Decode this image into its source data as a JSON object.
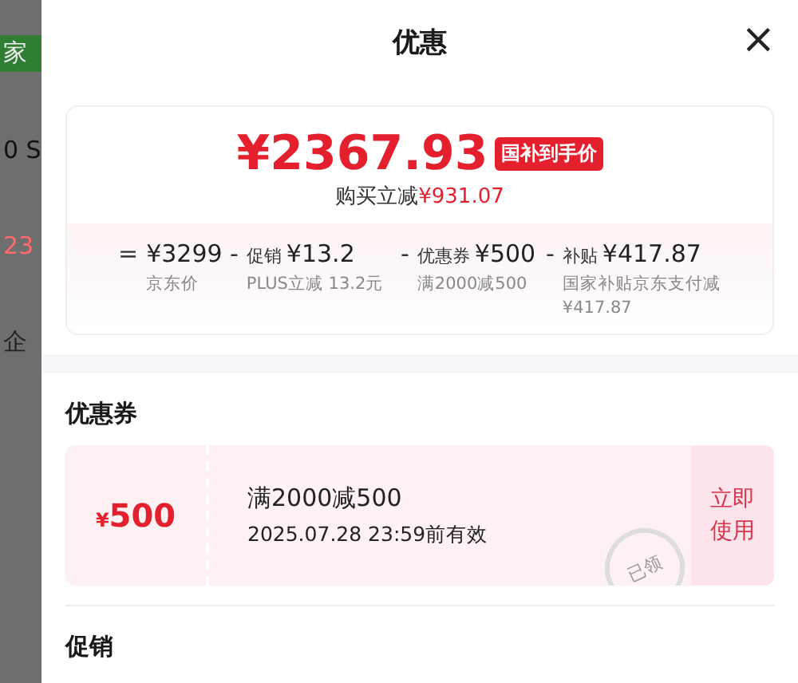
{
  "backdrop": {
    "texts": [
      "家",
      "0 S",
      "23",
      "企"
    ]
  },
  "dialog": {
    "title": "优惠",
    "close": "×"
  },
  "price_card": {
    "price": "¥2367.93",
    "badge": "国补到手价",
    "saving_label": "购买立减",
    "saving_value": "¥931.07",
    "breakdown": [
      {
        "op": "=",
        "value": "¥3299",
        "note": "京东价"
      },
      {
        "op": "-",
        "label": "促销",
        "value": "¥13.2",
        "note": "PLUS立减 13.2元"
      },
      {
        "op": "-",
        "label": "优惠券",
        "value": "¥500",
        "note": "满2000减500"
      },
      {
        "op": "-",
        "label": "补贴",
        "value": "¥417.87",
        "note": "国家补贴京东支付减¥417.87"
      }
    ]
  },
  "coupons": {
    "heading": "优惠券",
    "items": [
      {
        "currency": "¥",
        "amount": "500",
        "condition": "满2000减500",
        "validity": "2025.07.28 23:59前有效",
        "stamp": "已领",
        "claimed": true,
        "action": "立即使用"
      }
    ]
  },
  "promotions": {
    "heading": "促销"
  }
}
